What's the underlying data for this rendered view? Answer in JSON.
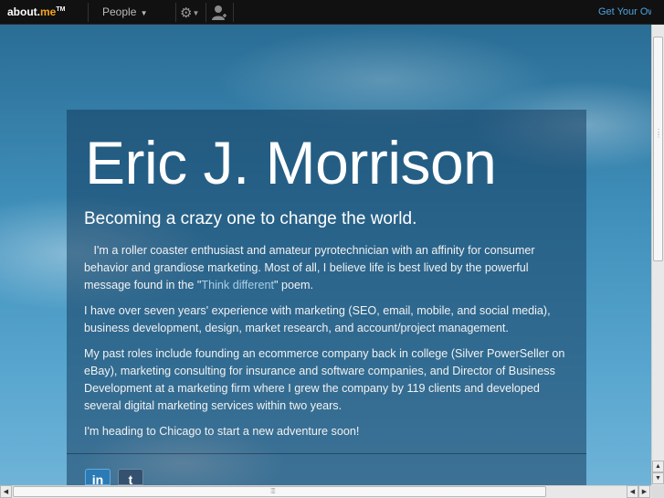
{
  "topbar": {
    "logo_prefix": "about.",
    "logo_accent": "me",
    "logo_tm": "TM",
    "people_label": "People",
    "get_yours_label": "Get Your Own"
  },
  "profile": {
    "name": "Eric J. Morrison",
    "headline": "Becoming a crazy one to change the world.",
    "bio": {
      "p1_before": "   I'm a roller coaster enthusiast and amateur pyrotechnician with an affinity for consumer behavior and grandiose marketing. Most of all, I believe life is best lived by the powerful message found in the \"",
      "p1_link": "Think different",
      "p1_after": "\" poem.",
      "p2": "I have over seven years' experience with marketing (SEO, email, mobile, and social media), business development, design, market research, and account/project management.",
      "p3": "My past roles include founding an ecommerce company back in college (Silver PowerSeller on eBay), marketing consulting for insurance and software companies, and Director of Business Development at a marketing firm where I grew the company by 119 clients and developed several digital marketing services within two years.",
      "p4": "I'm heading to Chicago to start a new adventure soon!"
    },
    "social": {
      "linkedin_label": "in",
      "tumblr_label": "t"
    }
  },
  "colors": {
    "topbar_bg": "#111111",
    "logo_accent": "#f5a623",
    "link": "#4da3e0",
    "linkedin": "#2a7ab5",
    "tumblr": "#34526f"
  }
}
